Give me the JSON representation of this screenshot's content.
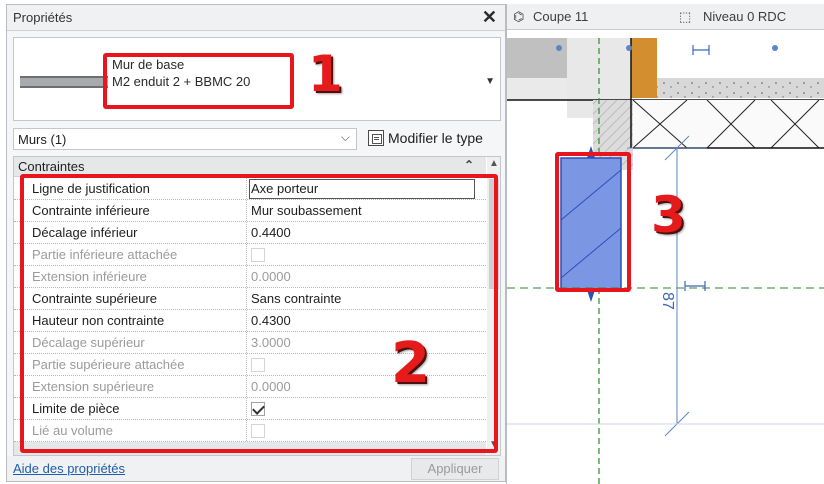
{
  "panel": {
    "title": "Propriétés",
    "close_glyph": "✕",
    "type_family": "Mur de base",
    "type_name": "M2 enduit 2 + BBMC 20",
    "type_dropdown_glyph": "▼",
    "filter_value": "Murs (1)",
    "filter_chevron": "⌵",
    "edit_type_label": "Modifier le type",
    "group_title": "Contraintes",
    "group_collapse_glyph": "⌃",
    "help_link": "Aide des propriétés",
    "apply_label": "Appliquer"
  },
  "rows": [
    {
      "label": "Ligne de justification",
      "value": "Axe porteur"
    },
    {
      "label": "Contrainte inférieure",
      "value": "Mur soubassement"
    },
    {
      "label": "Décalage inférieur",
      "value": "0.4400"
    },
    {
      "label": "Partie inférieure attachée",
      "value": ""
    },
    {
      "label": "Extension inférieure",
      "value": "0.0000"
    },
    {
      "label": "Contrainte supérieure",
      "value": "Sans contrainte"
    },
    {
      "label": "Hauteur non contrainte",
      "value": "0.4300"
    },
    {
      "label": "Décalage supérieur",
      "value": "3.0000"
    },
    {
      "label": "Partie supérieure attachée",
      "value": ""
    },
    {
      "label": "Extension supérieure",
      "value": "0.0000"
    },
    {
      "label": "Limite de pièce",
      "value": ""
    },
    {
      "label": "Lié au volume",
      "value": ""
    }
  ],
  "checkboxes": {
    "partie_inferieure_attachee": false,
    "partie_superieure_attachee": false,
    "limite_de_piece": true,
    "lie_au_volume": false
  },
  "annotations": {
    "n1": "1",
    "n2": "2",
    "n3": "3",
    "color": "#e8161c"
  },
  "view": {
    "tab_section": "Coupe 11",
    "tab_level": "Niveau 0 RDC",
    "dimension_text": "87",
    "wall_color": "#7b96e3"
  },
  "scroll": {
    "up_glyph": "▲",
    "down_glyph": "▼"
  }
}
